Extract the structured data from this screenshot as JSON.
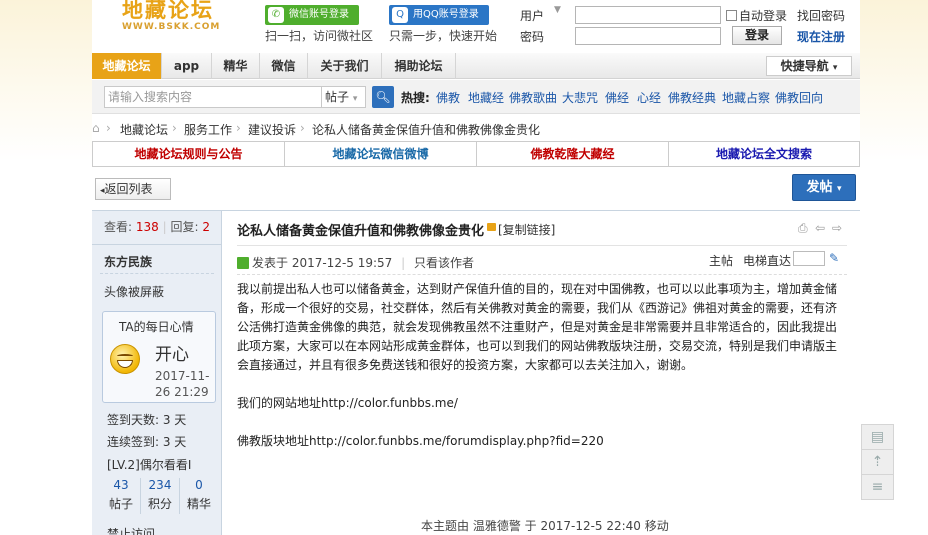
{
  "header": {
    "logo_text": "地藏论坛",
    "logo_sub": "WWW.BSKK.COM",
    "wechat_login": "微信账号登录",
    "wechat_hint": "扫一扫，访问微社区",
    "qq_login": "用QQ账号登录",
    "qq_hint": "只需一步，快速开始",
    "username_label": "用户",
    "password_label": "密码",
    "auto_login": "自动登录",
    "login_button": "登录",
    "forgot_password": "找回密码",
    "register": "现在注册"
  },
  "nav": {
    "items": [
      "地藏论坛",
      "app",
      "精华",
      "微信",
      "关于我们",
      "捐助论坛"
    ],
    "quick_nav": "快捷导航"
  },
  "search": {
    "placeholder": "请输入搜索内容",
    "type": "帖子",
    "hot_label": "热搜:",
    "hot_words": [
      "佛教",
      "地藏经",
      "佛教歌曲",
      "大悲咒",
      "佛经",
      "心经",
      "佛教经典",
      "地藏占察",
      "佛教回向"
    ]
  },
  "breadcrumb": [
    "地藏论坛",
    "服务工作",
    "建议投诉",
    "论私人储备黄金保值升值和佛教佛像金贵化"
  ],
  "notices": [
    {
      "label": "地藏论坛规则与公告",
      "color": "#c00000"
    },
    {
      "label": "地藏论坛微信微博",
      "color": "#1a6aa8"
    },
    {
      "label": "佛教乾隆大藏经",
      "color": "#c00000"
    },
    {
      "label": "地藏论坛全文搜索",
      "color": "#1a1ab0"
    }
  ],
  "actions": {
    "back": "返回列表",
    "post": "发帖"
  },
  "thread": {
    "views_label": "查看:",
    "views": "138",
    "replies_label": "回复:",
    "replies": "2",
    "title": "论私人储备黄金保值升值和佛教佛像金贵化",
    "copy_link": "[复制链接]"
  },
  "author": {
    "name": "东方民族",
    "avatar_note": "头像被屏蔽",
    "mood_title": "TA的每日心情",
    "mood": "开心",
    "mood_time": "2017-11-26 21:29",
    "signin_days": "签到天数: 3 天",
    "streak_days": "连续签到: 3 天",
    "level": "[LV.2]偶尔看看I",
    "posts": "43",
    "posts_label": "帖子",
    "credits": "234",
    "credits_label": "积分",
    "digest": "0",
    "digest_label": "精华",
    "more": "禁止访问"
  },
  "post": {
    "posted_at": "发表于 2017-12-5 19:57",
    "only_author": "只看该作者",
    "floor": "主帖",
    "jump_label": "电梯直达",
    "body": "我以前提出私人也可以储备黄金，达到财产保值升值的目的，现在对中国佛教，也可以以此事项为主，增加黄金储备，形成一个很好的交易，社交群体，然后有关佛教对黄金的需要，我们从《西游记》佛祖对黄金的需要，还有济公活佛打造黄金佛像的典范，就会发现佛教虽然不注重财产，但是对黄金是非常需要并且非常适合的，因此我提出此项方案，大家可以在本网站形成黄金群体，也可以到我们的网站佛教版块注册，交易交流，特别是我们申请版主会直接通过，并且有很多免费送钱和很好的投资方案，大家都可以去关注加入，谢谢。",
    "site_line": "我们的网站地址http://color.funbbs.me/",
    "forum_line": "佛教版块地址http://color.funbbs.me/forumdisplay.php?fid=220",
    "moved_note": "本主题由 温雅德警 于 2017-12-5 22:40 移动"
  }
}
